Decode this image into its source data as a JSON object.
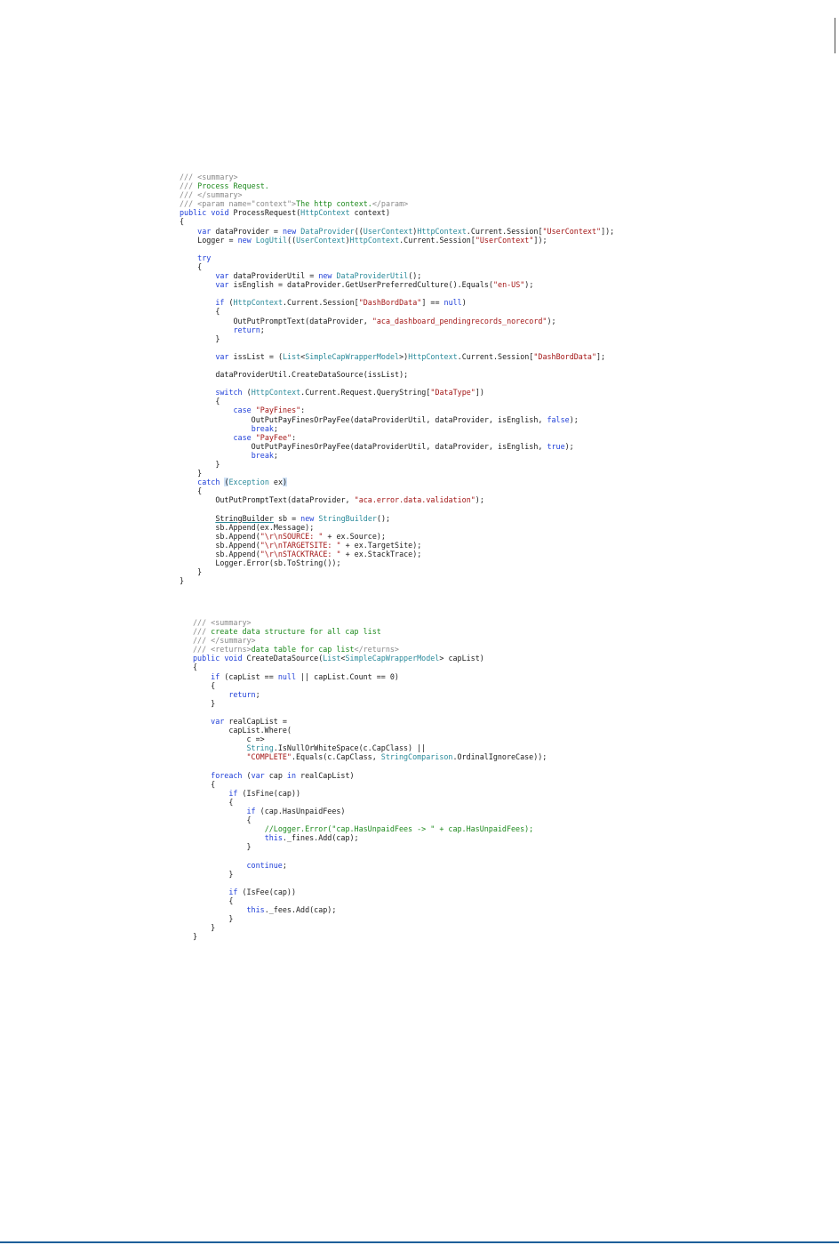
{
  "code_blocks": [
    {
      "name": "process-request",
      "lines": [
        [
          [
            "doc",
            "/// <summary>"
          ]
        ],
        [
          [
            "doc",
            "/// "
          ],
          [
            "com",
            "Process Request."
          ]
        ],
        [
          [
            "doc",
            "/// </summary>"
          ]
        ],
        [
          [
            "doc",
            "/// <param name=\"context\">"
          ],
          [
            "com",
            "The http context."
          ],
          [
            "doc",
            "</param>"
          ]
        ],
        [
          [
            "kw",
            "public"
          ],
          [
            "plain",
            " "
          ],
          [
            "kw",
            "void"
          ],
          [
            "plain",
            " ProcessRequest("
          ],
          [
            "type",
            "HttpContext"
          ],
          [
            "plain",
            " context)"
          ]
        ],
        [
          [
            "plain",
            "{"
          ]
        ],
        [
          [
            "plain",
            "    "
          ],
          [
            "kw",
            "var"
          ],
          [
            "plain",
            " dataProvider = "
          ],
          [
            "kw",
            "new"
          ],
          [
            "plain",
            " "
          ],
          [
            "type",
            "DataProvider"
          ],
          [
            "plain",
            "(("
          ],
          [
            "type",
            "UserContext"
          ],
          [
            "plain",
            ")"
          ],
          [
            "type",
            "HttpContext"
          ],
          [
            "plain",
            ".Current.Session["
          ],
          [
            "str",
            "\"UserContext\""
          ],
          [
            "plain",
            "]);"
          ]
        ],
        [
          [
            "plain",
            "    Logger = "
          ],
          [
            "kw",
            "new"
          ],
          [
            "plain",
            " "
          ],
          [
            "type",
            "LogUtil"
          ],
          [
            "plain",
            "(("
          ],
          [
            "type",
            "UserContext"
          ],
          [
            "plain",
            ")"
          ],
          [
            "type",
            "HttpContext"
          ],
          [
            "plain",
            ".Current.Session["
          ],
          [
            "str",
            "\"UserContext\""
          ],
          [
            "plain",
            "]);"
          ]
        ],
        [
          [
            "plain",
            ""
          ]
        ],
        [
          [
            "plain",
            "    "
          ],
          [
            "kw",
            "try"
          ]
        ],
        [
          [
            "plain",
            "    {"
          ]
        ],
        [
          [
            "plain",
            "        "
          ],
          [
            "kw",
            "var"
          ],
          [
            "plain",
            " dataProviderUtil = "
          ],
          [
            "kw",
            "new"
          ],
          [
            "plain",
            " "
          ],
          [
            "type",
            "DataProviderUtil"
          ],
          [
            "plain",
            "();"
          ]
        ],
        [
          [
            "plain",
            "        "
          ],
          [
            "kw",
            "var"
          ],
          [
            "plain",
            " isEnglish = dataProvider.GetUserPreferredCulture().Equals("
          ],
          [
            "str",
            "\"en-US\""
          ],
          [
            "plain",
            ");"
          ]
        ],
        [
          [
            "plain",
            ""
          ]
        ],
        [
          [
            "plain",
            "        "
          ],
          [
            "kw",
            "if"
          ],
          [
            "plain",
            " ("
          ],
          [
            "type",
            "HttpContext"
          ],
          [
            "plain",
            ".Current.Session["
          ],
          [
            "str",
            "\"DashBordData\""
          ],
          [
            "plain",
            "] == "
          ],
          [
            "kw",
            "null"
          ],
          [
            "plain",
            ")"
          ]
        ],
        [
          [
            "plain",
            "        {"
          ]
        ],
        [
          [
            "plain",
            "            OutPutPromptText(dataProvider, "
          ],
          [
            "str",
            "\"aca_dashboard_pendingrecords_norecord\""
          ],
          [
            "plain",
            ");"
          ]
        ],
        [
          [
            "plain",
            "            "
          ],
          [
            "kw",
            "return"
          ],
          [
            "plain",
            ";"
          ]
        ],
        [
          [
            "plain",
            "        }"
          ]
        ],
        [
          [
            "plain",
            ""
          ]
        ],
        [
          [
            "plain",
            "        "
          ],
          [
            "kw",
            "var"
          ],
          [
            "plain",
            " issList = ("
          ],
          [
            "type",
            "List"
          ],
          [
            "plain",
            "<"
          ],
          [
            "type",
            "SimpleCapWrapperModel"
          ],
          [
            "plain",
            ">)"
          ],
          [
            "type",
            "HttpContext"
          ],
          [
            "plain",
            ".Current.Session["
          ],
          [
            "str",
            "\"DashBordData\""
          ],
          [
            "plain",
            "];"
          ]
        ],
        [
          [
            "plain",
            ""
          ]
        ],
        [
          [
            "plain",
            "        dataProviderUtil.CreateDataSource(issList);"
          ]
        ],
        [
          [
            "plain",
            ""
          ]
        ],
        [
          [
            "plain",
            "        "
          ],
          [
            "kw",
            "switch"
          ],
          [
            "plain",
            " ("
          ],
          [
            "type",
            "HttpContext"
          ],
          [
            "plain",
            ".Current.Request.QueryString["
          ],
          [
            "str",
            "\"DataType\""
          ],
          [
            "plain",
            "])"
          ]
        ],
        [
          [
            "plain",
            "        {"
          ]
        ],
        [
          [
            "plain",
            "            "
          ],
          [
            "kw",
            "case"
          ],
          [
            "plain",
            " "
          ],
          [
            "str",
            "\"PayFines\""
          ],
          [
            "plain",
            ":"
          ]
        ],
        [
          [
            "plain",
            "                OutPutPayFinesOrPayFee(dataProviderUtil, dataProvider, isEnglish, "
          ],
          [
            "kw",
            "false"
          ],
          [
            "plain",
            ");"
          ]
        ],
        [
          [
            "plain",
            "                "
          ],
          [
            "kw",
            "break"
          ],
          [
            "plain",
            ";"
          ]
        ],
        [
          [
            "plain",
            "            "
          ],
          [
            "kw",
            "case"
          ],
          [
            "plain",
            " "
          ],
          [
            "str",
            "\"PayFee\""
          ],
          [
            "plain",
            ":"
          ]
        ],
        [
          [
            "plain",
            "                OutPutPayFinesOrPayFee(dataProviderUtil, dataProvider, isEnglish, "
          ],
          [
            "kw",
            "true"
          ],
          [
            "plain",
            ");"
          ]
        ],
        [
          [
            "plain",
            "                "
          ],
          [
            "kw",
            "break"
          ],
          [
            "plain",
            ";"
          ]
        ],
        [
          [
            "plain",
            "        }"
          ]
        ],
        [
          [
            "plain",
            "    }"
          ]
        ],
        [
          [
            "plain",
            "    "
          ],
          [
            "kw",
            "catch"
          ],
          [
            "plain",
            " "
          ],
          [
            "hl",
            "("
          ],
          [
            "type",
            "Exception"
          ],
          [
            "plain",
            " ex"
          ],
          [
            "hl",
            ")"
          ]
        ],
        [
          [
            "plain",
            "    {"
          ]
        ],
        [
          [
            "plain",
            "        OutPutPromptText(dataProvider, "
          ],
          [
            "str",
            "\"aca.error.data.validation\""
          ],
          [
            "plain",
            ");"
          ]
        ],
        [
          [
            "plain",
            ""
          ]
        ],
        [
          [
            "plain",
            "        "
          ],
          [
            "ul",
            "StringBuilder"
          ],
          [
            "plain",
            " sb = "
          ],
          [
            "kw",
            "new"
          ],
          [
            "plain",
            " "
          ],
          [
            "type",
            "StringBuilder"
          ],
          [
            "plain",
            "();"
          ]
        ],
        [
          [
            "plain",
            "        sb.Append(ex.Message);"
          ]
        ],
        [
          [
            "plain",
            "        sb.Append("
          ],
          [
            "str",
            "\"\\r\\nSOURCE: \""
          ],
          [
            "plain",
            " + ex.Source);"
          ]
        ],
        [
          [
            "plain",
            "        sb.Append("
          ],
          [
            "str",
            "\"\\r\\nTARGETSITE: \""
          ],
          [
            "plain",
            " + ex.TargetSite);"
          ]
        ],
        [
          [
            "plain",
            "        sb.Append("
          ],
          [
            "str",
            "\"\\r\\nSTACKTRACE: \""
          ],
          [
            "plain",
            " + ex.StackTrace);"
          ]
        ],
        [
          [
            "plain",
            "        Logger.Error(sb.ToString());"
          ]
        ],
        [
          [
            "plain",
            "    }"
          ]
        ],
        [
          [
            "plain",
            "}"
          ]
        ]
      ]
    },
    {
      "name": "create-data-source",
      "lines": [
        [
          [
            "doc",
            "/// <summary>"
          ]
        ],
        [
          [
            "doc",
            "/// "
          ],
          [
            "com",
            "create data structure for all cap list"
          ]
        ],
        [
          [
            "doc",
            "/// </summary>"
          ]
        ],
        [
          [
            "doc",
            "/// <returns>"
          ],
          [
            "com",
            "data table for cap list"
          ],
          [
            "doc",
            "</returns>"
          ]
        ],
        [
          [
            "kw",
            "public"
          ],
          [
            "plain",
            " "
          ],
          [
            "kw",
            "void"
          ],
          [
            "plain",
            " CreateDataSource("
          ],
          [
            "type",
            "List"
          ],
          [
            "plain",
            "<"
          ],
          [
            "type",
            "SimpleCapWrapperModel"
          ],
          [
            "plain",
            "> capList)"
          ]
        ],
        [
          [
            "plain",
            "{"
          ]
        ],
        [
          [
            "plain",
            "    "
          ],
          [
            "kw",
            "if"
          ],
          [
            "plain",
            " (capList == "
          ],
          [
            "kw",
            "null"
          ],
          [
            "plain",
            " || capList.Count == 0)"
          ]
        ],
        [
          [
            "plain",
            "    {"
          ]
        ],
        [
          [
            "plain",
            "        "
          ],
          [
            "kw",
            "return"
          ],
          [
            "plain",
            ";"
          ]
        ],
        [
          [
            "plain",
            "    }"
          ]
        ],
        [
          [
            "plain",
            ""
          ]
        ],
        [
          [
            "plain",
            "    "
          ],
          [
            "kw",
            "var"
          ],
          [
            "plain",
            " realCapList ="
          ]
        ],
        [
          [
            "plain",
            "        capList.Where("
          ]
        ],
        [
          [
            "plain",
            "            c =>"
          ]
        ],
        [
          [
            "plain",
            "            "
          ],
          [
            "type",
            "String"
          ],
          [
            "plain",
            ".IsNullOrWhiteSpace(c.CapClass) ||"
          ]
        ],
        [
          [
            "plain",
            "            "
          ],
          [
            "str",
            "\"COMPLETE\""
          ],
          [
            "plain",
            ".Equals(c.CapClass, "
          ],
          [
            "type",
            "StringComparison"
          ],
          [
            "plain",
            ".OrdinalIgnoreCase));"
          ]
        ],
        [
          [
            "plain",
            ""
          ]
        ],
        [
          [
            "plain",
            "    "
          ],
          [
            "kw",
            "foreach"
          ],
          [
            "plain",
            " ("
          ],
          [
            "kw",
            "var"
          ],
          [
            "plain",
            " cap "
          ],
          [
            "kw",
            "in"
          ],
          [
            "plain",
            " realCapList)"
          ]
        ],
        [
          [
            "plain",
            "    {"
          ]
        ],
        [
          [
            "plain",
            "        "
          ],
          [
            "kw",
            "if"
          ],
          [
            "plain",
            " (IsFine(cap))"
          ]
        ],
        [
          [
            "plain",
            "        {"
          ]
        ],
        [
          [
            "plain",
            "            "
          ],
          [
            "kw",
            "if"
          ],
          [
            "plain",
            " (cap.HasUnpaidFees)"
          ]
        ],
        [
          [
            "plain",
            "            {"
          ]
        ],
        [
          [
            "plain",
            "                "
          ],
          [
            "com",
            "//Logger.Error(\"cap.HasUnpaidFees -> \" + cap.HasUnpaidFees);"
          ]
        ],
        [
          [
            "plain",
            "                "
          ],
          [
            "kw",
            "this"
          ],
          [
            "plain",
            "._fines.Add(cap);"
          ]
        ],
        [
          [
            "plain",
            "            }"
          ]
        ],
        [
          [
            "plain",
            ""
          ]
        ],
        [
          [
            "plain",
            "            "
          ],
          [
            "kw",
            "continue"
          ],
          [
            "plain",
            ";"
          ]
        ],
        [
          [
            "plain",
            "        }"
          ]
        ],
        [
          [
            "plain",
            ""
          ]
        ],
        [
          [
            "plain",
            "        "
          ],
          [
            "kw",
            "if"
          ],
          [
            "plain",
            " (IsFee(cap))"
          ]
        ],
        [
          [
            "plain",
            "        {"
          ]
        ],
        [
          [
            "plain",
            "            "
          ],
          [
            "kw",
            "this"
          ],
          [
            "plain",
            "._fees.Add(cap);"
          ]
        ],
        [
          [
            "plain",
            "        }"
          ]
        ],
        [
          [
            "plain",
            "    }"
          ]
        ],
        [
          [
            "plain",
            "}"
          ]
        ]
      ]
    }
  ]
}
